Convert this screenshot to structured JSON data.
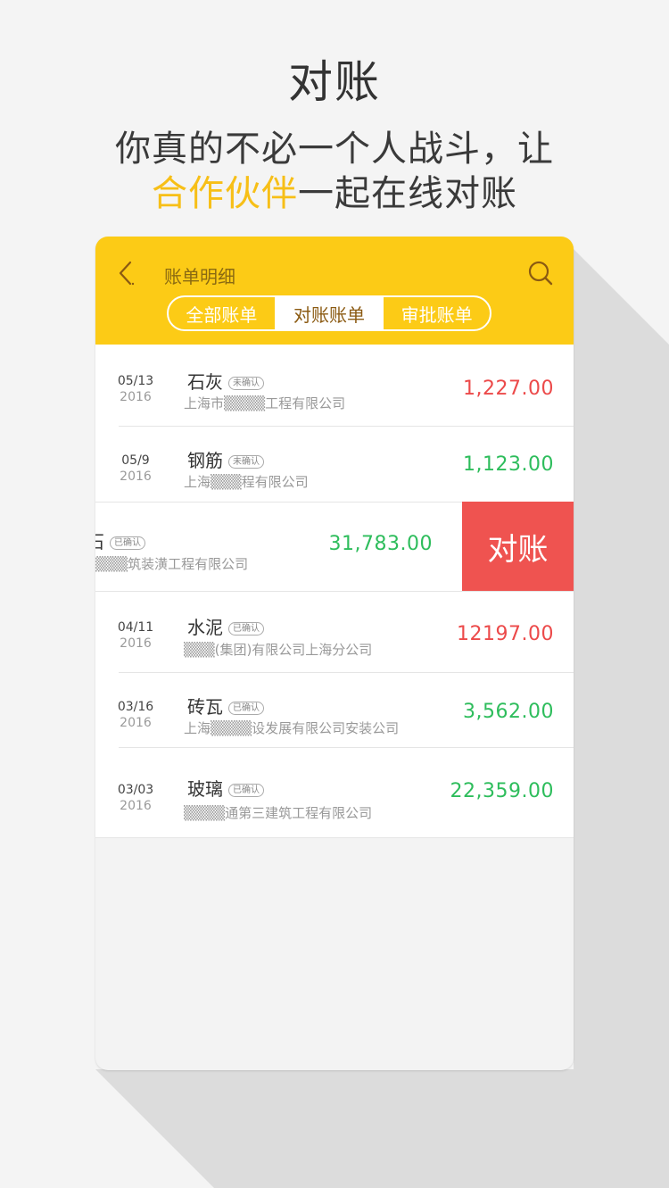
{
  "headline": {
    "title": "对账",
    "line1": "你真的不必一个人战斗，让",
    "line2_highlight": "合作伙伴",
    "line2_rest": "一起在线对账"
  },
  "nav": {
    "title": "账单明细",
    "back_icon": "back-chevron-icon",
    "search_icon": "search-icon"
  },
  "tabs": [
    {
      "label": "全部账单",
      "active": false
    },
    {
      "label": "对账账单",
      "active": true
    },
    {
      "label": "审批账单",
      "active": false
    }
  ],
  "bills": [
    {
      "date": "05/13",
      "year": "2016",
      "material": "石灰",
      "status": "未确认",
      "company": "上海市▒▒▒▒工程有限公司",
      "amount": "1,227.00",
      "amount_color": "red"
    },
    {
      "date": "05/9",
      "year": "2016",
      "material": "钢筋",
      "status": "未确认",
      "company": "上海▒▒▒程有限公司",
      "amount": "1,123.00",
      "amount_color": "green"
    },
    {
      "date": "",
      "year": "",
      "material": "石",
      "status": "已确认",
      "company": "▒▒▒▒筑装潢工程有限公司",
      "amount": "31,783.00",
      "amount_color": "green"
    },
    {
      "date": "04/11",
      "year": "2016",
      "material": "水泥",
      "status": "已确认",
      "company": "▒▒▒(集团)有限公司上海分公司",
      "amount": "12197.00",
      "amount_color": "red"
    },
    {
      "date": "03/16",
      "year": "2016",
      "material": "砖瓦",
      "status": "已确认",
      "company": "上海▒▒▒▒设发展有限公司安装公司",
      "amount": "3,562.00",
      "amount_color": "green"
    },
    {
      "date": "03/03",
      "year": "2016",
      "material": "玻璃",
      "status": "已确认",
      "company": "▒▒▒▒通第三建筑工程有限公司",
      "amount": "22,359.00",
      "amount_color": "green"
    }
  ],
  "swipe_action": {
    "label": "对账"
  },
  "colors": {
    "brand_yellow": "#fccb16",
    "highlight": "#f7bf17",
    "amount_red": "#ec4a4a",
    "amount_green": "#2ebd5c",
    "action_red": "#ef5350"
  }
}
